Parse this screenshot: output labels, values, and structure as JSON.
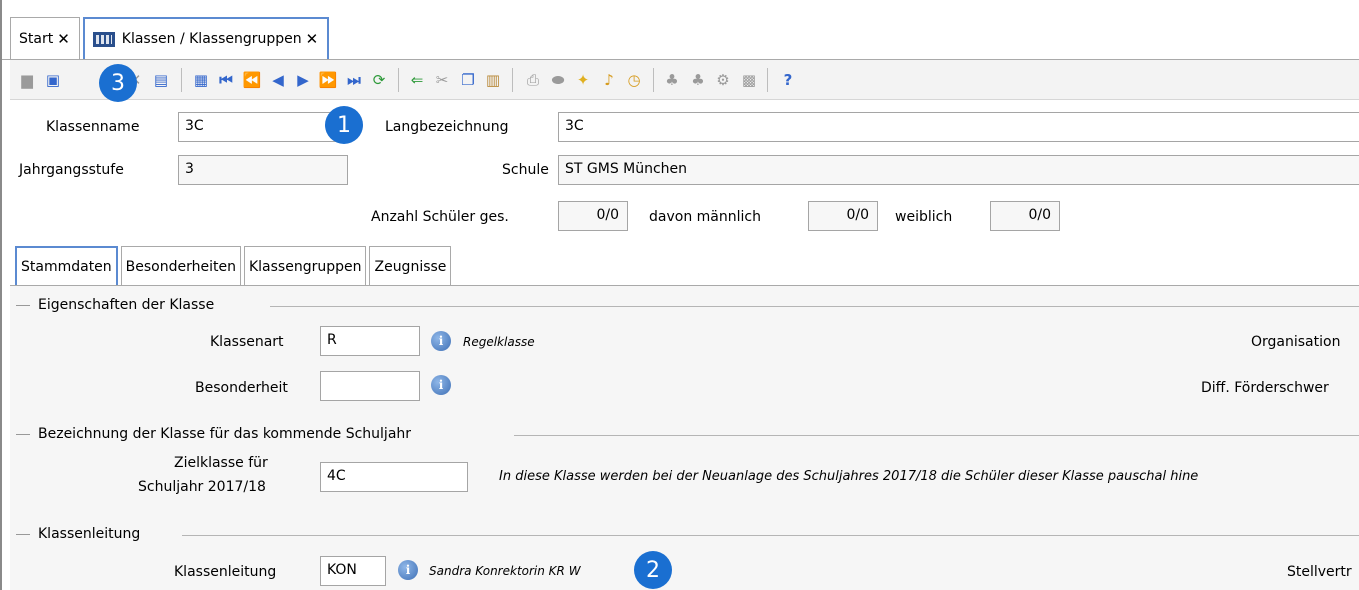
{
  "tabs": [
    {
      "label": "Start"
    },
    {
      "label": "Klassen / Klassengruppen"
    }
  ],
  "close_glyph": "✕",
  "badges": {
    "b1": "1",
    "b2": "2",
    "b3": "3"
  },
  "header": {
    "klassenname_label": "Klassenname",
    "klassenname_value": "3C",
    "langbezeichnung_label": "Langbezeichnung",
    "langbezeichnung_value": "3C",
    "jahrgangsstufe_label": "Jahrgangsstufe",
    "jahrgangsstufe_value": "3",
    "schule_label": "Schule",
    "schule_value": "ST GMS München",
    "anzahl_label": "Anzahl Schüler ges.",
    "anzahl_value": "0/0",
    "maennlich_label": "davon männlich",
    "maennlich_value": "0/0",
    "weiblich_label": "weiblich",
    "weiblich_value": "0/0"
  },
  "inner_tabs": [
    {
      "label": "Stammdaten"
    },
    {
      "label": "Besonderheiten"
    },
    {
      "label": "Klassengruppen"
    },
    {
      "label": "Zeugnisse"
    }
  ],
  "stammdaten": {
    "group1": "Eigenschaften der Klasse",
    "klassenart_label": "Klassenart",
    "klassenart_value": "R",
    "klassenart_hint": "Regelklasse",
    "besonderheit_label": "Besonderheit",
    "besonderheit_value": "",
    "organisation_label": "Organisation",
    "diff_label": "Diff. Förderschwer",
    "group2": "Bezeichnung der Klasse für das kommende Schuljahr",
    "zielklasse_label_1": "Zielklasse für",
    "zielklasse_label_2": "Schuljahr 2017/18",
    "zielklasse_value": "4C",
    "zielklasse_hint": "In diese Klasse werden bei der Neuanlage des Schuljahres 2017/18 die Schüler dieser Klasse pauschal hine",
    "group3": "Klassenleitung",
    "klassenleitung_label": "Klassenleitung",
    "klassenleitung_value": "KON",
    "klassenleitung_hint": "Sandra Konrektorin KR W",
    "stellvertr_label": "Stellvertr"
  },
  "colors": {
    "accent": "#1a6fd1",
    "tab_border": "#5b8ad1"
  }
}
